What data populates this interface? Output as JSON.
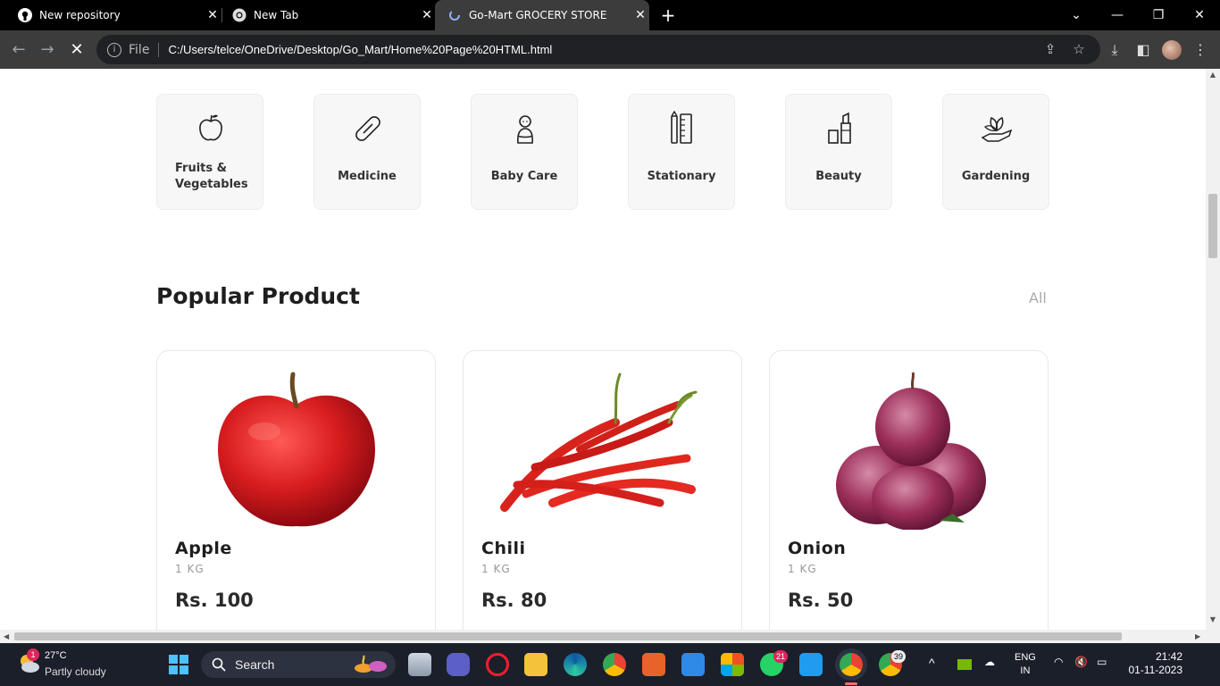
{
  "browser": {
    "tabs": [
      {
        "title": "New repository",
        "icon": "github-icon"
      },
      {
        "title": "New Tab",
        "icon": "chrome-icon"
      },
      {
        "title": "Go-Mart GROCERY STORE",
        "icon": "loading-icon",
        "active": true
      }
    ],
    "address": {
      "scheme_label": "File",
      "url": "C:/Users/telce/OneDrive/Desktop/Go_Mart/Home%20Page%20HTML.html"
    }
  },
  "categories": [
    {
      "label": "Fruits & Vegetables",
      "line1": "Fruits &",
      "line2": "Vegetables",
      "icon": "apple-icon"
    },
    {
      "label": "Medicine",
      "icon": "pill-icon"
    },
    {
      "label": "Baby Care",
      "icon": "baby-icon"
    },
    {
      "label": "Stationary",
      "icon": "stationery-icon"
    },
    {
      "label": "Beauty",
      "icon": "cosmetics-icon"
    },
    {
      "label": "Gardening",
      "icon": "plant-hand-icon"
    }
  ],
  "popular": {
    "title": "Popular Product",
    "all_label": "All",
    "products": [
      {
        "name": "Apple",
        "qty": "1 KG",
        "price": "Rs. 100"
      },
      {
        "name": "Chili",
        "qty": "1 KG",
        "price": "Rs. 80"
      },
      {
        "name": "Onion",
        "qty": "1 KG",
        "price": "Rs. 50"
      }
    ]
  },
  "taskbar": {
    "weather_temp": "27°C",
    "weather_desc": "Partly cloudy",
    "weather_badge": "1",
    "search_label": "Search",
    "whatsapp_badge": "21",
    "chrome2_badge": "39",
    "lang_line1": "ENG",
    "lang_line2": "IN",
    "time": "21:42",
    "date": "01-11-2023"
  },
  "colors": {
    "accent_red": "#e02424",
    "page_bg": "#ffffff",
    "card_bg": "#f7f7f7"
  }
}
